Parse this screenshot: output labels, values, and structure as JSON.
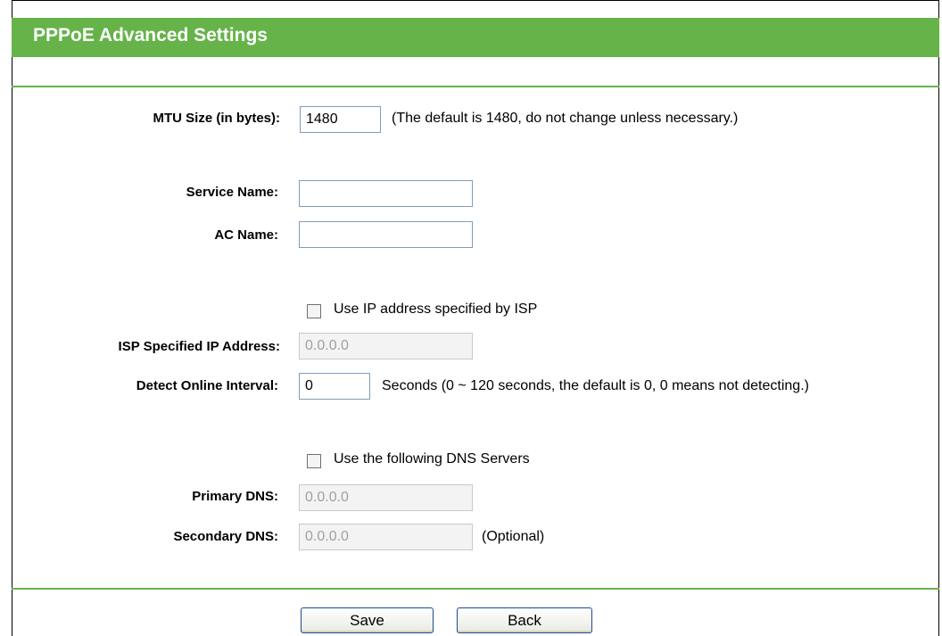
{
  "header": {
    "title": "PPPoE Advanced Settings"
  },
  "form": {
    "mtu": {
      "label": "MTU Size (in bytes):",
      "value": "1480",
      "note": "(The default is 1480, do not change unless necessary.)"
    },
    "service_name": {
      "label": "Service Name:",
      "value": ""
    },
    "ac_name": {
      "label": "AC Name:",
      "value": ""
    },
    "use_isp_ip": {
      "label": "Use IP address specified by ISP",
      "checked": false
    },
    "isp_ip": {
      "label": "ISP Specified IP Address:",
      "value": "0.0.0.0"
    },
    "detect_interval": {
      "label": "Detect Online Interval:",
      "value": "0",
      "note": "Seconds (0 ~ 120 seconds, the default is 0, 0 means not detecting.)"
    },
    "use_dns": {
      "label": "Use the following DNS Servers",
      "checked": false
    },
    "primary_dns": {
      "label": "Primary DNS:",
      "value": "0.0.0.0"
    },
    "secondary_dns": {
      "label": "Secondary DNS:",
      "value": "0.0.0.0",
      "note": "(Optional)"
    }
  },
  "buttons": {
    "save": "Save",
    "back": "Back"
  },
  "colors": {
    "accent": "#66b34a"
  }
}
